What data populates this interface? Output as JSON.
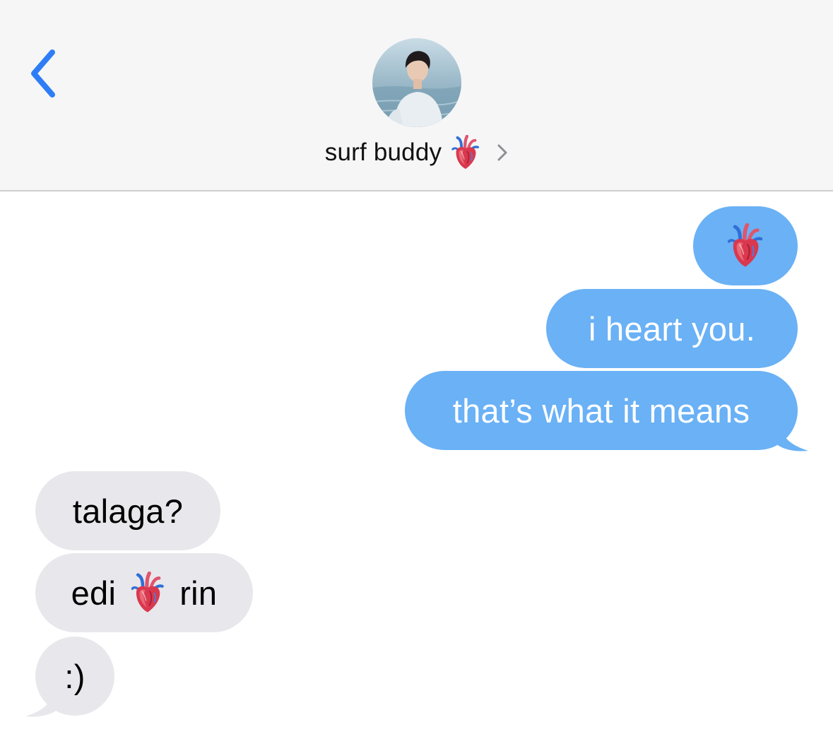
{
  "header": {
    "back_icon": "chevron-left-icon",
    "contact_name": "surf buddy",
    "contact_emoji": "anatomical-heart-icon",
    "detail_icon": "chevron-right-icon",
    "accent_color": "#2f7df6"
  },
  "messages": [
    {
      "direction": "sent",
      "emoji_only": true,
      "emoji": "anatomical-heart-icon"
    },
    {
      "direction": "sent",
      "text": "i heart you."
    },
    {
      "direction": "sent",
      "text": "that’s what it means"
    },
    {
      "direction": "received",
      "text": "talaga?"
    },
    {
      "direction": "received",
      "text_before": "edi",
      "emoji": "anatomical-heart-icon",
      "text_after": "rin"
    },
    {
      "direction": "received",
      "text": ":)"
    }
  ],
  "colors": {
    "sent_bubble": "#6ab1f5",
    "received_bubble": "#e8e7ec",
    "header_bg": "#f6f6f7"
  }
}
